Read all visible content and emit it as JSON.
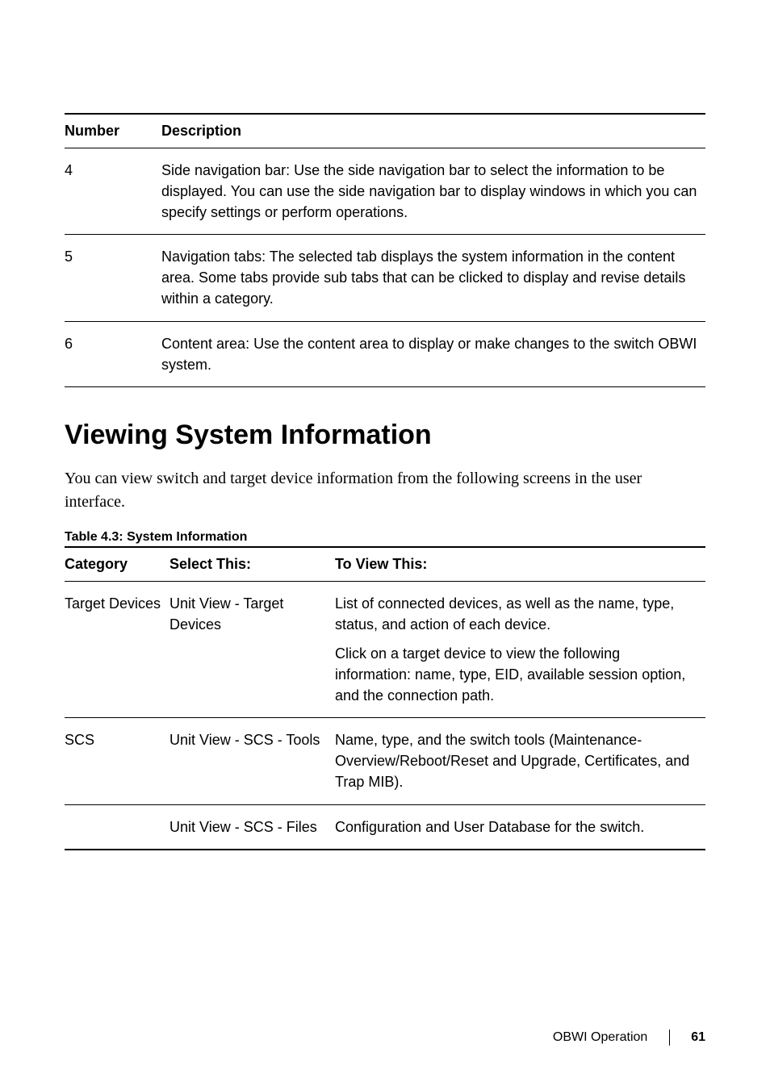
{
  "table1": {
    "headers": {
      "number": "Number",
      "description": "Description"
    },
    "rows": [
      {
        "number": "4",
        "description": "Side navigation bar: Use the side navigation bar to select the information to be displayed. You can use the side navigation bar to display windows in which you can specify settings or perform operations."
      },
      {
        "number": "5",
        "description": "Navigation tabs: The selected tab displays the system information in the content area. Some tabs provide sub tabs that can be clicked to display and revise details within a category."
      },
      {
        "number": "6",
        "description": "Content area: Use the content area to display or make changes to the switch OBWI system."
      }
    ]
  },
  "heading": "Viewing System Information",
  "intro": "You can view switch and target device information from the following screens in the user interface.",
  "table2_caption": "Table 4.3: System Information",
  "table2": {
    "headers": {
      "category": "Category",
      "select": "Select This:",
      "view": "To View This:"
    },
    "rows": [
      {
        "category": "Target Devices",
        "select": "Unit View - Target Devices",
        "view_p1": "List of connected devices, as well as the name, type, status, and action of each device.",
        "view_p2": "Click on a target device to view the following information: name, type, EID, available session option, and the connection path."
      },
      {
        "category": "SCS",
        "select": "Unit View - SCS - Tools",
        "view_p1": "Name, type, and the switch tools (Maintenance-Overview/Reboot/Reset and Upgrade, Certificates, and Trap MIB)."
      },
      {
        "category": "",
        "select": "Unit View - SCS - Files",
        "view_p1": "Configuration and User Database for the switch."
      }
    ]
  },
  "footer": {
    "section": "OBWI Operation",
    "page": "61"
  }
}
